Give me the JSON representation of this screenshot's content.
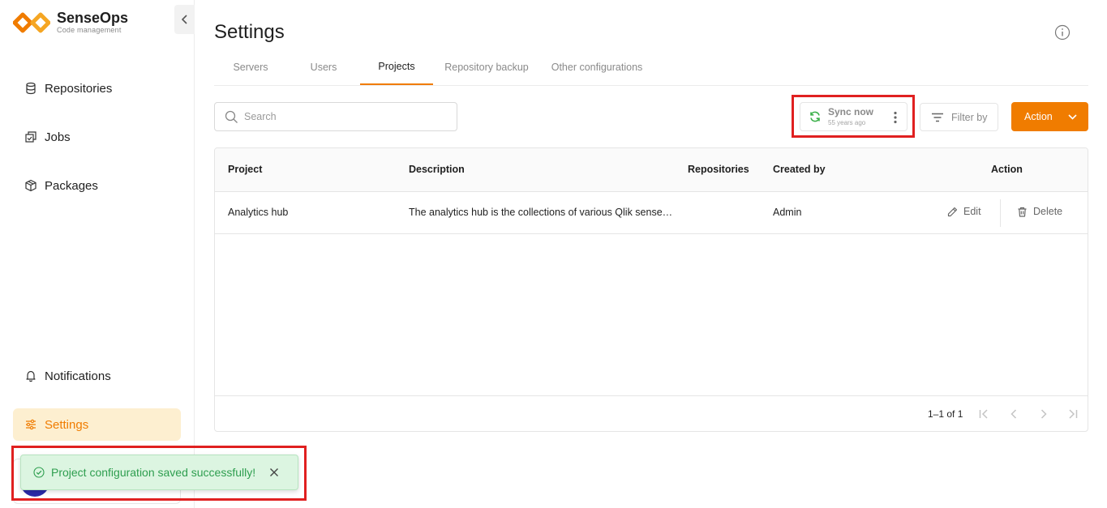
{
  "brand": {
    "name": "SenseOps",
    "subtitle": "Code management",
    "accent": "#f07c00"
  },
  "sidebar": {
    "collapse_icon": "chevron-left-icon",
    "items": [
      {
        "label": "Repositories",
        "icon": "database-icon"
      },
      {
        "label": "Jobs",
        "icon": "jobs-icon"
      },
      {
        "label": "Packages",
        "icon": "package-icon"
      },
      {
        "label": "Notifications",
        "icon": "bell-icon"
      },
      {
        "label": "Settings",
        "icon": "sliders-icon",
        "active": true
      }
    ]
  },
  "page": {
    "title": "Settings",
    "info_icon": "info-icon"
  },
  "tabs": [
    {
      "label": "Servers"
    },
    {
      "label": "Users"
    },
    {
      "label": "Projects",
      "active": true
    },
    {
      "label": "Repository backup"
    },
    {
      "label": "Other configurations"
    }
  ],
  "toolbar": {
    "search_placeholder": "Search",
    "sync_label": "Sync now",
    "sync_time": "55 years ago",
    "filter_label": "Filter by",
    "action_label": "Action"
  },
  "table": {
    "headers": {
      "project": "Project",
      "description": "Description",
      "repositories": "Repositories",
      "created_by": "Created by",
      "action": "Action"
    },
    "rows": [
      {
        "project": "Analytics hub",
        "description": "The analytics hub is the collections of various Qlik sense…",
        "repositories": "",
        "created_by": "Admin",
        "edit_label": "Edit",
        "delete_label": "Delete"
      }
    ],
    "pagination": {
      "range": "1–1 of 1"
    }
  },
  "toast": {
    "message": "Project configuration saved successfully!",
    "status_color": "#2e9e4f"
  }
}
